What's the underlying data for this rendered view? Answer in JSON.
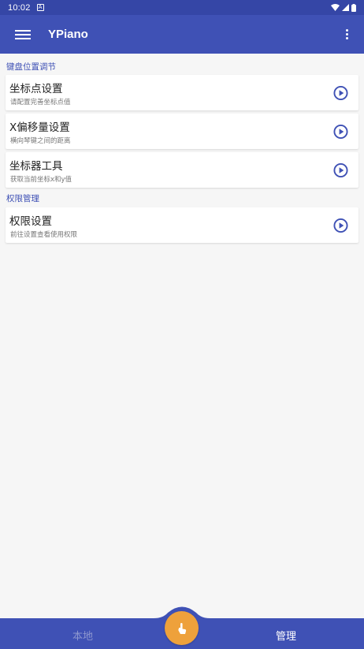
{
  "status_bar": {
    "time": "10:02",
    "notif_letter": "A"
  },
  "app": {
    "title": "YPiano"
  },
  "sections": [
    {
      "header": "键盘位置调节"
    },
    {
      "header": "权限管理"
    }
  ],
  "cards": [
    {
      "title": "坐标点设置",
      "subtitle": "请配置完善坐标点值"
    },
    {
      "title": "X偏移量设置",
      "subtitle": "横向琴键之间的距离"
    },
    {
      "title": "坐标器工具",
      "subtitle": "获取当前坐标x和y值"
    },
    {
      "title": "权限设置",
      "subtitle": "前往设置查看使用权限"
    }
  ],
  "bottom_nav": {
    "local_label": "本地",
    "manage_label": "管理"
  },
  "colors": {
    "primary": "#3f51b5",
    "accent": "#eea13b",
    "status": "#3546a6"
  },
  "icons": {
    "play": "play-circle-icon",
    "menu": "hamburger-icon",
    "more": "more-vert-icon",
    "fab": "touch-icon"
  }
}
